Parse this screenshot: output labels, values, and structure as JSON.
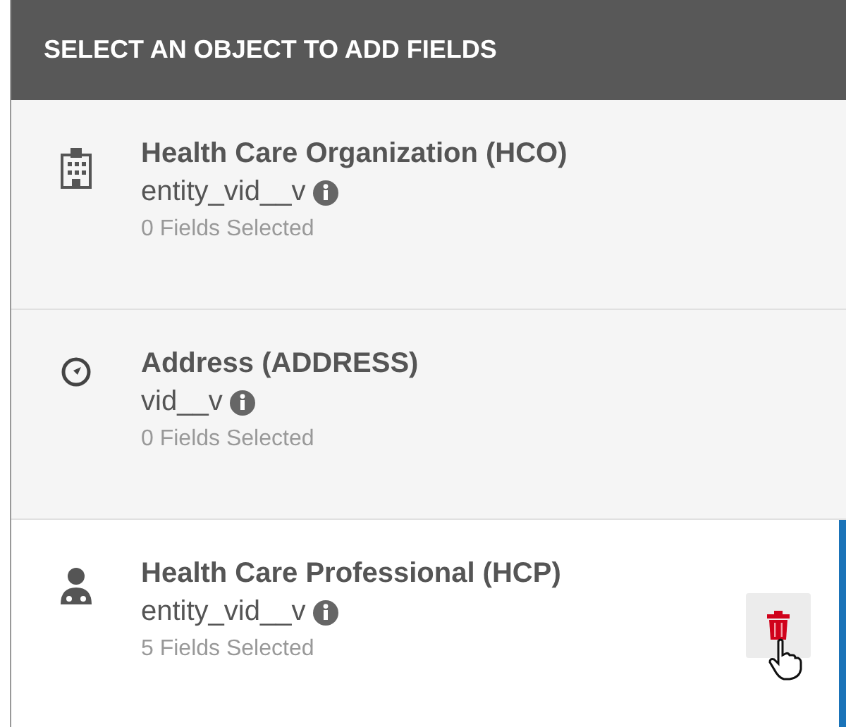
{
  "header": {
    "title": "SELECT AN OBJECT TO ADD FIELDS"
  },
  "objects": [
    {
      "kind": "organization",
      "name": "Health Care Organization (HCO)",
      "key": "entity_vid__v",
      "count": "0 Fields Selected",
      "selected": false
    },
    {
      "kind": "address",
      "name": "Address (ADDRESS)",
      "key": "vid__v",
      "count": "0 Fields Selected",
      "selected": false
    },
    {
      "kind": "professional",
      "name": "Health Care Professional (HCP)",
      "key": "entity_vid__v",
      "count": "5 Fields Selected",
      "selected": true
    }
  ]
}
